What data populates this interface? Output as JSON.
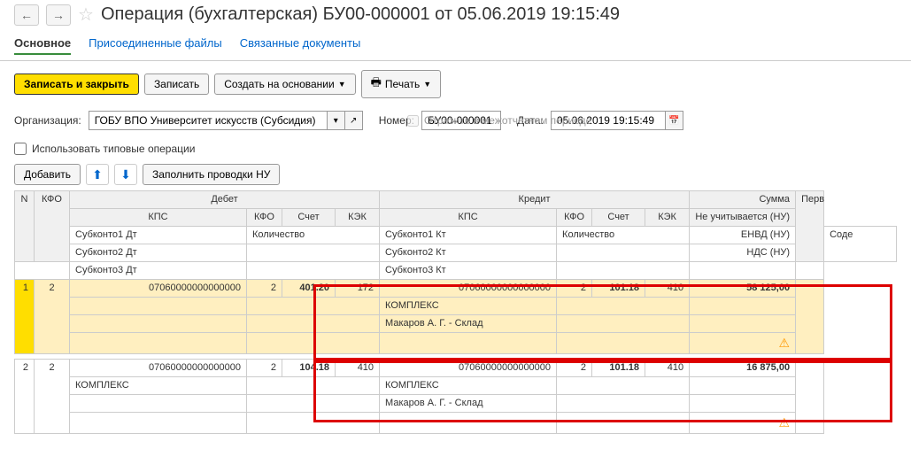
{
  "header": {
    "title": "Операция (бухгалтерская) БУ00-000001 от 05.06.2019 19:15:49"
  },
  "tabs": {
    "main": "Основное",
    "files": "Присоединенные файлы",
    "related": "Связанные документы"
  },
  "toolbar": {
    "save_close": "Записать и закрыть",
    "save": "Записать",
    "create_from": "Создать на основании",
    "print": "Печать"
  },
  "form": {
    "org_label": "Организация:",
    "org_value": "ГОБУ ВПО Университет искусств (Субсидия)",
    "number_label": "Номер:",
    "number_value": "БУ00-000001",
    "date_label": "Дата:",
    "date_value": "05.06.2019 19:15:49",
    "reflect": "Отразить в межотчетном периоде",
    "use_typical": "Использовать типовые операции"
  },
  "table_toolbar": {
    "add": "Добавить",
    "fill_nu": "Заполнить проводки НУ"
  },
  "columns": {
    "n": "N",
    "kfo": "КФО",
    "debit": "Дебет",
    "credit": "Кредит",
    "sum": "Сумма",
    "perv": "Перв",
    "kps": "КПС",
    "kfo2": "КФО",
    "account": "Счет",
    "kek": "КЭК",
    "not_counted": "Не учитывается (НУ)",
    "sub1dt": "Субконто1 Дт",
    "sub2dt": "Субконто2 Дт",
    "sub3dt": "Субконто3 Дт",
    "qty": "Количество",
    "sub1kt": "Субконто1 Кт",
    "sub2kt": "Субконто2 Кт",
    "sub3kt": "Субконто3 Кт",
    "envd": "ЕНВД (НУ)",
    "nds": "НДС (НУ)",
    "sode": "Соде"
  },
  "rows": [
    {
      "n": "1",
      "kfo": "2",
      "dt_kps": "07060000000000000",
      "dt_kfo": "2",
      "dt_acc": "401.20",
      "dt_kek": "172",
      "kt_kps": "07060000000000000",
      "kt_kfo": "2",
      "kt_acc": "101.18",
      "kt_kek": "410",
      "sum": "58 125,00",
      "kt_sub1": "КОМПЛЕКС",
      "kt_sub2": "Макаров А. Г. - Склад"
    },
    {
      "n": "2",
      "kfo": "2",
      "dt_kps": "07060000000000000",
      "dt_kfo": "2",
      "dt_acc": "104.18",
      "dt_kek": "410",
      "kt_kps": "07060000000000000",
      "kt_kfo": "2",
      "kt_acc": "101.18",
      "kt_kek": "410",
      "sum": "16 875,00",
      "dt_sub1": "КОМПЛЕКС",
      "kt_sub1": "КОМПЛЕКС",
      "kt_sub2": "Макаров А. Г. - Склад"
    }
  ]
}
